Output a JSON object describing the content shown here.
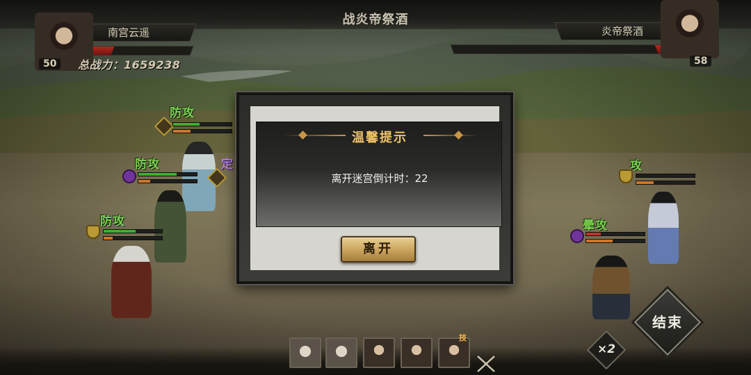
{
  "header": {
    "title": "战炎帝祭酒"
  },
  "player": {
    "name": "南宫云遥",
    "level": "50",
    "power_text": "总战力：1659238",
    "hp_fraction": 0.35
  },
  "enemy": {
    "name": "炎帝祭酒",
    "level": "58",
    "hp_fraction": 0.08
  },
  "units": {
    "ally1": {
      "tag": "防攻"
    },
    "ally2": {
      "tag": "防攻"
    },
    "ally3": {
      "tag": "防攻"
    },
    "ally4": {
      "tag": "定"
    },
    "enemy1": {
      "tag": "攻"
    },
    "enemy2": {
      "tag": "晕攻"
    }
  },
  "dialog": {
    "title": "温馨提示",
    "message": "离开迷宫倒计时：22",
    "button_label": "离开"
  },
  "controls": {
    "end_label": "结束",
    "speed_label": "×2",
    "skill_badge": "技"
  },
  "colors": {
    "hp": "#c32c22",
    "unit_tag": "#86e35a",
    "dialog_title": "#f0c36a",
    "button": "#c9a35c"
  }
}
